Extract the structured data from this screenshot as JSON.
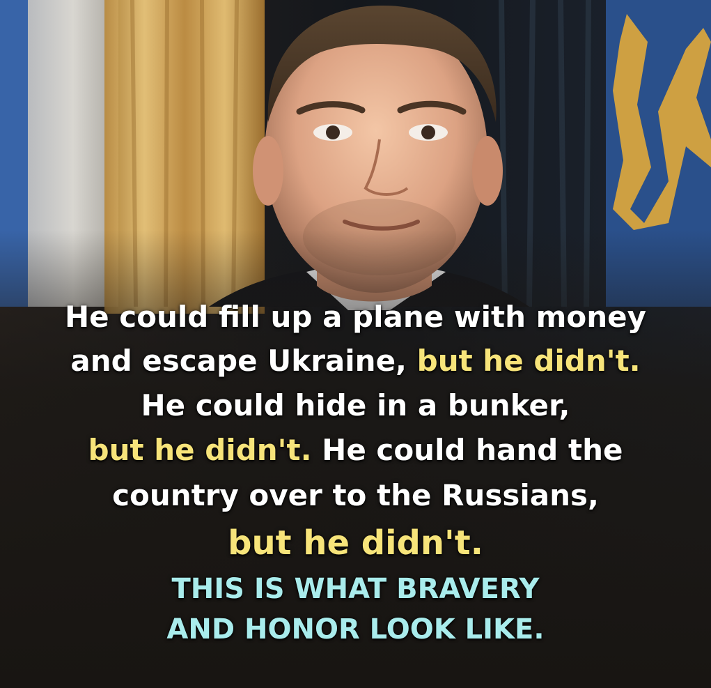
{
  "caption": {
    "line1": "He could fill up a plane with money",
    "line2_a": "and escape Ukraine, ",
    "line2_b": "but he didn't.",
    "line3": "He could hide in a bunker,",
    "line4_a": "but he didn't.",
    "line4_b": " He could hand the",
    "line5": "country over to the Russians,",
    "line6": "but he didn't.",
    "line7": "THIS IS WHAT BRAVERY",
    "line8": "AND HONOR LOOK LIKE."
  },
  "colors": {
    "white_text": "#ffffff",
    "highlight_yellow": "#f7e47a",
    "tagline_cyan": "#a9ecec",
    "flag_blue": "#2b5aa0",
    "emblem_gold": "#e0a93a"
  }
}
